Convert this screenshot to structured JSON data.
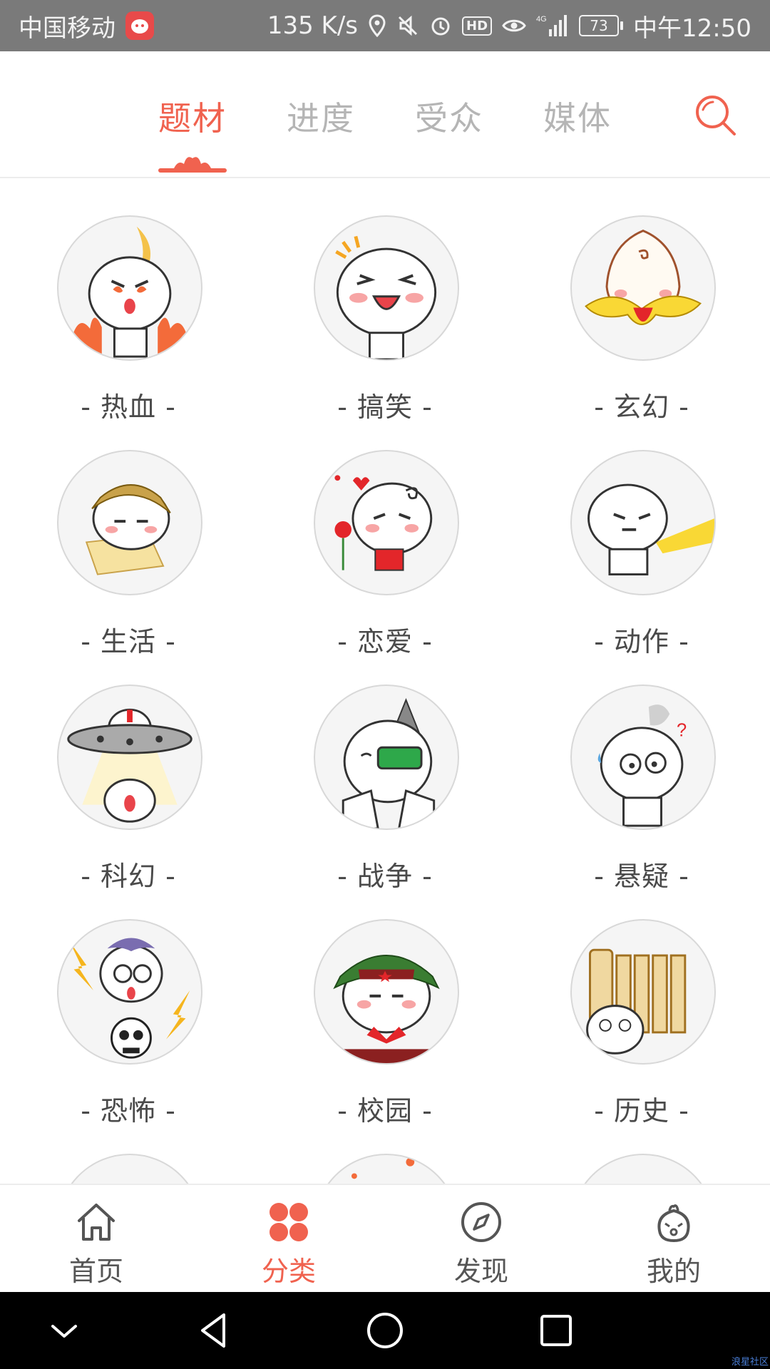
{
  "status_bar": {
    "carrier": "中国移动",
    "speed": "135 K/s",
    "network": "4G",
    "hd": "HD",
    "battery": "73",
    "time": "中午12:50"
  },
  "top_tabs": [
    {
      "label": "题材",
      "active": true
    },
    {
      "label": "进度",
      "active": false
    },
    {
      "label": "受众",
      "active": false
    },
    {
      "label": "媒体",
      "active": false
    }
  ],
  "categories": [
    {
      "label": "- 热血 -",
      "icon": "hot-blooded-icon"
    },
    {
      "label": "- 搞笑 -",
      "icon": "comedy-icon"
    },
    {
      "label": "- 玄幻 -",
      "icon": "fantasy-icon"
    },
    {
      "label": "- 生活 -",
      "icon": "daily-life-icon"
    },
    {
      "label": "- 恋爱 -",
      "icon": "romance-icon"
    },
    {
      "label": "- 动作 -",
      "icon": "action-icon"
    },
    {
      "label": "- 科幻 -",
      "icon": "sci-fi-icon"
    },
    {
      "label": "- 战争 -",
      "icon": "war-icon"
    },
    {
      "label": "- 悬疑 -",
      "icon": "mystery-icon"
    },
    {
      "label": "- 恐怖 -",
      "icon": "horror-icon"
    },
    {
      "label": "- 校园 -",
      "icon": "campus-icon"
    },
    {
      "label": "- 历史 -",
      "icon": "history-icon"
    }
  ],
  "bottom_nav": [
    {
      "label": "首页",
      "icon": "home-icon",
      "active": false
    },
    {
      "label": "分类",
      "icon": "category-icon",
      "active": true
    },
    {
      "label": "发现",
      "icon": "compass-icon",
      "active": false
    },
    {
      "label": "我的",
      "icon": "profile-mascot-icon",
      "active": false
    }
  ],
  "watermark": "浪星社区",
  "colors": {
    "accent": "#f0624f",
    "status_bar": "#7a7a7a",
    "inactive_tab": "#b5b5b5",
    "label": "#4a4a4a"
  }
}
